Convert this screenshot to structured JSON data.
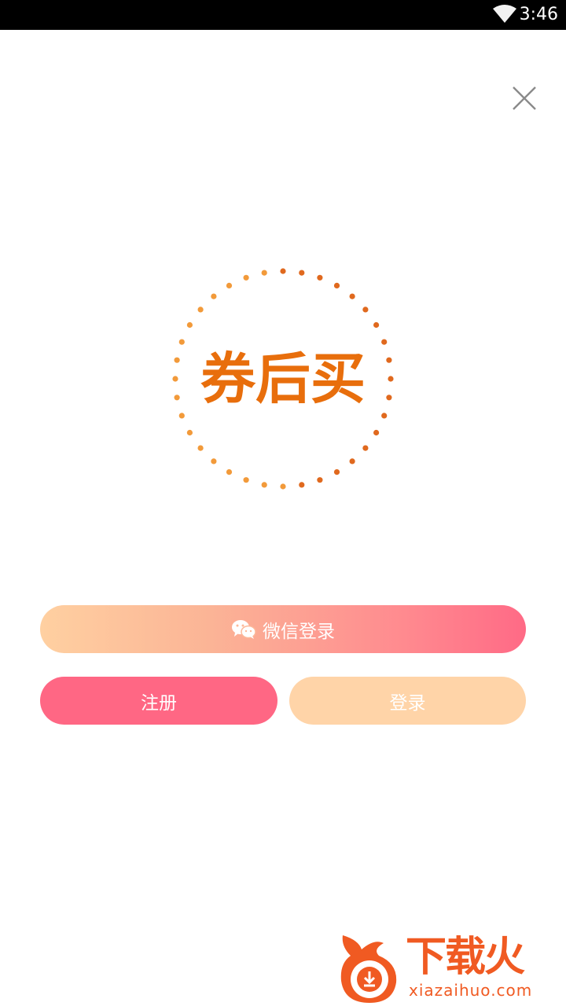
{
  "status_bar": {
    "time": "3:46",
    "wifi_icon": "wifi-icon"
  },
  "close_icon": "close-icon",
  "logo": {
    "text": "券后买",
    "dot_color": "#e9842a",
    "text_color": "#e86e0c"
  },
  "buttons": {
    "wechat_login": "微信登录",
    "wechat_icon": "wechat-icon",
    "register": "注册",
    "login": "登录"
  },
  "colors": {
    "register_bg": "#ff6784",
    "login_bg": "#ffd4a8",
    "wechat_gradient_start": "#ffd0a1",
    "wechat_gradient_end": "#ff6a86"
  },
  "watermark": {
    "title": "下载火",
    "url": "xiazaihuo.com",
    "color": "#f05a22"
  }
}
